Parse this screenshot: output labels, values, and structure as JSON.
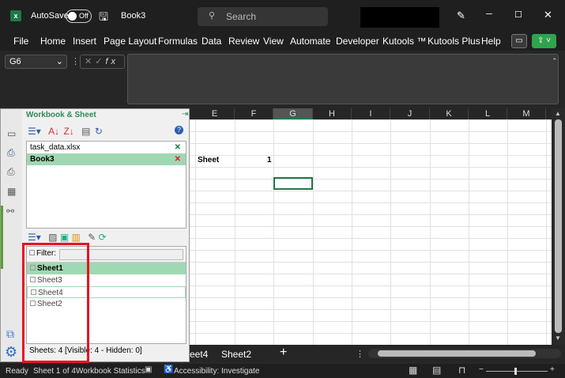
{
  "titlebar": {
    "autosave_label": "AutoSave",
    "autosave_state": "Off",
    "doc_title": "Book3",
    "search_placeholder": "Search"
  },
  "ribbon_tabs": [
    "File",
    "Home",
    "Insert",
    "Page Layout",
    "Formulas",
    "Data",
    "Review",
    "View",
    "Automate",
    "Developer",
    "Kutools ™",
    "Kutools Plus",
    "Help"
  ],
  "formula_bar": {
    "name_box": "G6",
    "fx": "fx",
    "value": ""
  },
  "columns": [
    "E",
    "F",
    "G",
    "H",
    "I",
    "J",
    "K",
    "L",
    "M"
  ],
  "cells": {
    "e4": "Sheet",
    "f4": "1"
  },
  "panel": {
    "title": "Workbook & Sheet",
    "workbooks": [
      "task_data.xlsx",
      "Book3"
    ],
    "filter_label": "Filter:",
    "filter_value": "",
    "sheets": [
      "Sheet1",
      "Sheet3",
      "Sheet4",
      "Sheet2"
    ],
    "footer": "Sheets: 4  [Visible: 4 - Hidden: 0]"
  },
  "sheet_tabs": [
    "eet4",
    "Sheet2"
  ],
  "add_sheet": "+",
  "status": {
    "ready": "Ready",
    "sheet": "Sheet 1 of 4",
    "stats": "Workbook Statistics",
    "accessibility": "Accessibility: Investigate"
  },
  "colors": {
    "accent": "#1d7a44",
    "selection": "#a0d8b3",
    "highlight": "#e81123"
  }
}
